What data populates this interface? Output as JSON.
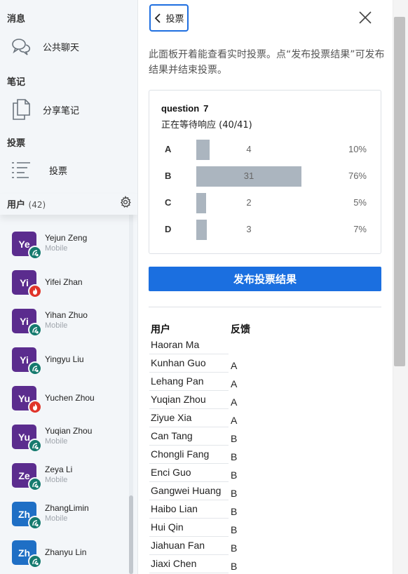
{
  "sidebar": {
    "messages": {
      "title": "消息",
      "items": [
        {
          "label": "公共聊天",
          "icon": "chat-bubbles-icon"
        }
      ]
    },
    "notes": {
      "title": "笔记",
      "items": [
        {
          "label": "分享笔记",
          "icon": "document-copy-icon"
        }
      ]
    },
    "polls": {
      "title": "投票",
      "items": [
        {
          "label": "投票",
          "icon": "list-icon"
        }
      ]
    },
    "users": {
      "title": "用户",
      "count": "(42)",
      "settings_icon": "gear-icon",
      "list": [
        {
          "initials": "",
          "name": "",
          "sub": "",
          "badge": "web"
        },
        {
          "initials": "Ye",
          "name": "Yejun Zeng",
          "sub": "Mobile",
          "badge": "mobile"
        },
        {
          "initials": "Yi",
          "name": "Yifei Zhan",
          "sub": "",
          "badge": "web"
        },
        {
          "initials": "Yi",
          "name": "Yihan Zhuo",
          "sub": "Mobile",
          "badge": "mobile"
        },
        {
          "initials": "Yi",
          "name": "Yingyu Liu",
          "sub": "",
          "badge": "mobile"
        },
        {
          "initials": "Yu",
          "name": "Yuchen Zhou",
          "sub": "",
          "badge": "web"
        },
        {
          "initials": "Yu",
          "name": "Yuqian Zhou",
          "sub": "Mobile",
          "badge": "mobile"
        },
        {
          "initials": "Ze",
          "name": "Zeya Li",
          "sub": "Mobile",
          "badge": "mobile"
        },
        {
          "initials": "Zh",
          "name": "ZhangLimin",
          "sub": "Mobile",
          "badge": "mobile"
        },
        {
          "initials": "Zh",
          "name": "Zhanyu Lin",
          "sub": "",
          "badge": "mobile"
        }
      ]
    }
  },
  "panel": {
    "back_label": "投票",
    "back_icon": "chevron-left-icon",
    "close_icon": "close-icon",
    "description": "此面板开着能查看实时投票。点“发布投票结果”可发布结果并结束投票。",
    "poll": {
      "question_label": "question",
      "question_number": "7",
      "status": "正在等待响应 (40/41)",
      "options": [
        {
          "key": "A",
          "count": 4,
          "percent": "10%",
          "fraction": 0.1
        },
        {
          "key": "B",
          "count": 31,
          "percent": "76%",
          "fraction": 0.76
        },
        {
          "key": "C",
          "count": 2,
          "percent": "5%",
          "fraction": 0.05
        },
        {
          "key": "D",
          "count": 3,
          "percent": "7%",
          "fraction": 0.07
        }
      ]
    },
    "publish_label": "发布投票结果",
    "responses": {
      "col_user": "用户",
      "col_answer": "反馈",
      "rows": [
        {
          "name": "Haoran Ma",
          "answer": ""
        },
        {
          "name": "Kunhan Guo",
          "answer": "A"
        },
        {
          "name": "Lehang Pan",
          "answer": "A"
        },
        {
          "name": "Yuqian Zhou",
          "answer": "A"
        },
        {
          "name": "Ziyue Xia",
          "answer": "A"
        },
        {
          "name": "Can Tang",
          "answer": "B"
        },
        {
          "name": "Chongli Fang",
          "answer": "B"
        },
        {
          "name": "Enci Guo",
          "answer": "B"
        },
        {
          "name": "Gangwei Huang",
          "answer": "B"
        },
        {
          "name": "Haibo Lian",
          "answer": "B"
        },
        {
          "name": "Hui Qin",
          "answer": "B"
        },
        {
          "name": "Jiahuan Fan",
          "answer": "B"
        },
        {
          "name": "Jiaxi Chen",
          "answer": "B"
        }
      ]
    }
  },
  "colors": {
    "accent": "#1b6fe0",
    "avatar_purple": "#5b2c8e",
    "avatar_blue": "#1f6fc5",
    "badge_web": "#e0342a",
    "badge_mobile": "#157a6e",
    "bar": "#abb5bf"
  }
}
